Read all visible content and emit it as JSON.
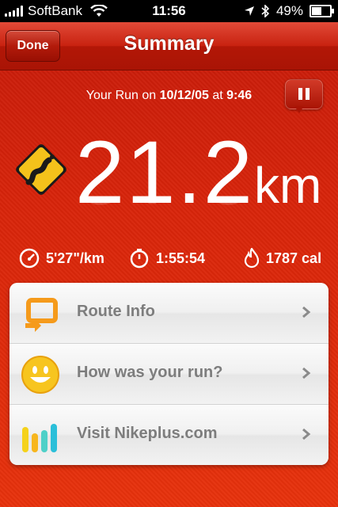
{
  "status_bar": {
    "carrier": "SoftBank",
    "time": "11:56",
    "battery": "49%",
    "battery_level": 0.49
  },
  "nav": {
    "done_label": "Done",
    "title": "Summary"
  },
  "run": {
    "prefix": "Your Run on",
    "date": "10/12/05",
    "at": "at",
    "time": "9:46"
  },
  "distance": {
    "value": "21.2",
    "unit": "km"
  },
  "stats": {
    "pace": "5'27\"/km",
    "duration": "1:55:54",
    "calories": "1787 cal"
  },
  "menu": [
    {
      "label": "Route Info",
      "icon": "route-icon"
    },
    {
      "label": "How was your run?",
      "icon": "smiley-icon"
    },
    {
      "label": "Visit Nikeplus.com",
      "icon": "bars-icon"
    }
  ],
  "colors": {
    "accent": "#c41a0a",
    "card": "#f4f4f4",
    "label": "#7d7d7d"
  }
}
